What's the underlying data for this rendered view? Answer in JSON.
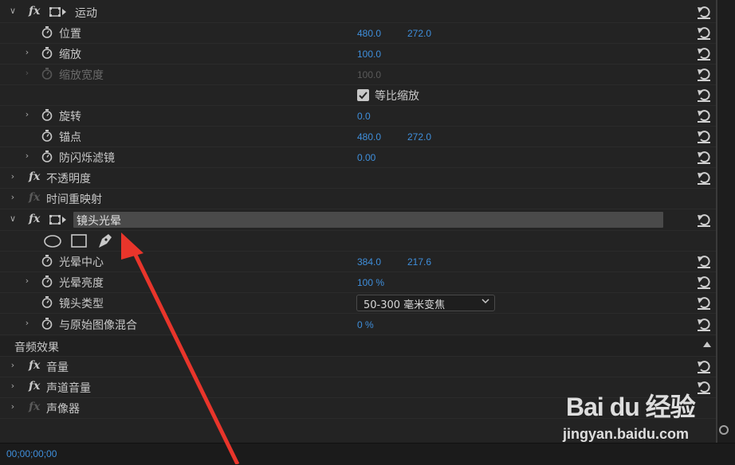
{
  "motion": {
    "name": "运动",
    "properties": {
      "position": {
        "label": "位置",
        "x": "480.0",
        "y": "272.0"
      },
      "scale": {
        "label": "缩放",
        "value": "100.0"
      },
      "scale_width": {
        "label": "缩放宽度",
        "value": "100.0"
      },
      "uniform_scale": {
        "label": "等比缩放",
        "checked": true
      },
      "rotation": {
        "label": "旋转",
        "value": "0.0"
      },
      "anchor": {
        "label": "锚点",
        "x": "480.0",
        "y": "272.0"
      },
      "anti_flicker": {
        "label": "防闪烁滤镜",
        "value": "0.00"
      }
    }
  },
  "opacity": {
    "name": "不透明度"
  },
  "time_remap": {
    "name": "时间重映射"
  },
  "lens_flare": {
    "name": "镜头光晕",
    "properties": {
      "flare_center": {
        "label": "光晕中心",
        "x": "384.0",
        "y": "217.6"
      },
      "flare_brightness": {
        "label": "光晕亮度",
        "value": "100 %"
      },
      "lens_type": {
        "label": "镜头类型",
        "value": "50-300 毫米变焦"
      },
      "blend": {
        "label": "与原始图像混合",
        "value": "0 %"
      }
    }
  },
  "audio_effects": {
    "title": "音频效果",
    "items": [
      {
        "name": "音量"
      },
      {
        "name": "声道音量"
      },
      {
        "name": "声像器"
      }
    ]
  },
  "footer": {
    "timecode": "00;00;00;00"
  },
  "watermark": {
    "brand": "Bai du 经验",
    "url": "jingyan.baidu.com"
  },
  "colors": {
    "accent_blue": "#3f8fdc",
    "arrow_red": "#e8352b"
  }
}
